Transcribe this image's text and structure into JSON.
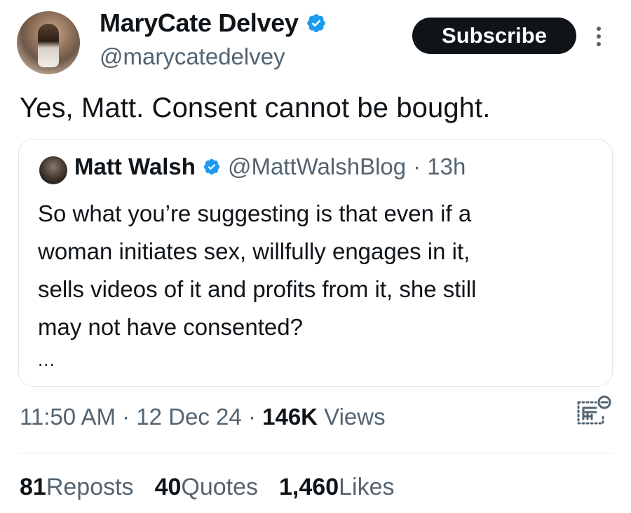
{
  "author": {
    "name": "MaryCate Delvey",
    "handle": "@marycatedelvey",
    "verified_color": "#1d9bf0"
  },
  "subscribe_label": "Subscribe",
  "tweet": {
    "text": "Yes, Matt. Consent cannot be bought."
  },
  "quoted": {
    "name": "Matt Walsh",
    "handle": "@MattWalshBlog",
    "time": "· 13h",
    "lines": [
      "So what you’re suggesting is that even if a",
      "woman initiates sex, willfully engages in it,",
      "sells videos of it and profits from it, she still",
      "may not have consented?"
    ],
    "ellipsis": "..."
  },
  "meta": {
    "time": "11:50 AM",
    "sep1": "·",
    "date": "12 Dec 24",
    "sep2": "·",
    "views_count": "146K",
    "views_label": "Views"
  },
  "stats": {
    "reposts_count": "81",
    "reposts_label": "Reposts",
    "quotes_count": "40",
    "quotes_label": "Quotes",
    "likes_count": "1,460",
    "likes_label": "Likes"
  },
  "icons": [
    "verified-badge-icon",
    "more-options-icon",
    "analytics-icon"
  ]
}
